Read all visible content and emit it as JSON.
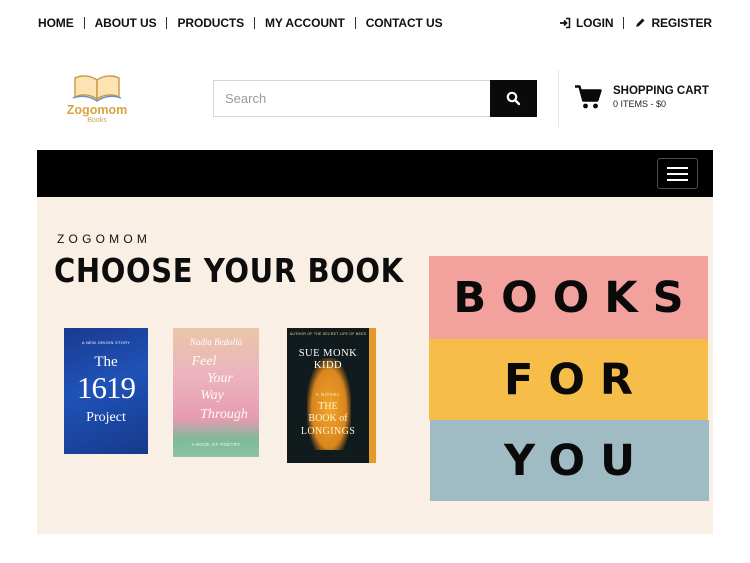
{
  "nav": {
    "links": [
      "HOME",
      "ABOUT US",
      "PRODUCTS",
      "MY ACCOUNT",
      "CONTACT US"
    ],
    "login_label": "LOGIN",
    "register_label": "REGISTER"
  },
  "header": {
    "logo_name": "Zogomom",
    "logo_sub": "Books",
    "search_placeholder": "Search",
    "search_value": "",
    "cart_title": "SHOPPING CART",
    "cart_summary": "0 ITEMS - $0"
  },
  "banner": {
    "kicker": "ZOGOMOM",
    "headline": "CHOOSE YOUR BOOK",
    "stripes": [
      "BOOKS",
      "FOR",
      "YOU"
    ],
    "books": [
      {
        "top_line": "A NEW ORIGIN STORY",
        "title_line1": "The",
        "title_line2": "1619",
        "title_line3": "Project"
      },
      {
        "author": "Nadia Bedolla",
        "title_line1": "Feel",
        "title_line2": "Your",
        "title_line3": "Way",
        "title_line4": "Through",
        "bottom_line": "A BOOK OF POETRY"
      },
      {
        "top_line": "AUTHOR OF THE SECRET LIFE OF BEES",
        "author": "SUE MONK KIDD",
        "kicker": "A NOVEL",
        "title_line1": "THE",
        "title_line2": "BOOK of",
        "title_line3": "LONGINGS"
      }
    ]
  },
  "colors": {
    "stripe_pink": "#f2a19c",
    "stripe_yellow": "#f6bd48",
    "stripe_blue": "#9fbcc4",
    "banner_bg": "#faefe5",
    "logo_gold": "#d9a441"
  },
  "icons": {
    "login": "sign-in-icon",
    "register": "pencil-icon",
    "search": "search-icon",
    "cart": "cart-icon",
    "menu": "hamburger-menu-icon",
    "logo": "open-book-icon"
  }
}
